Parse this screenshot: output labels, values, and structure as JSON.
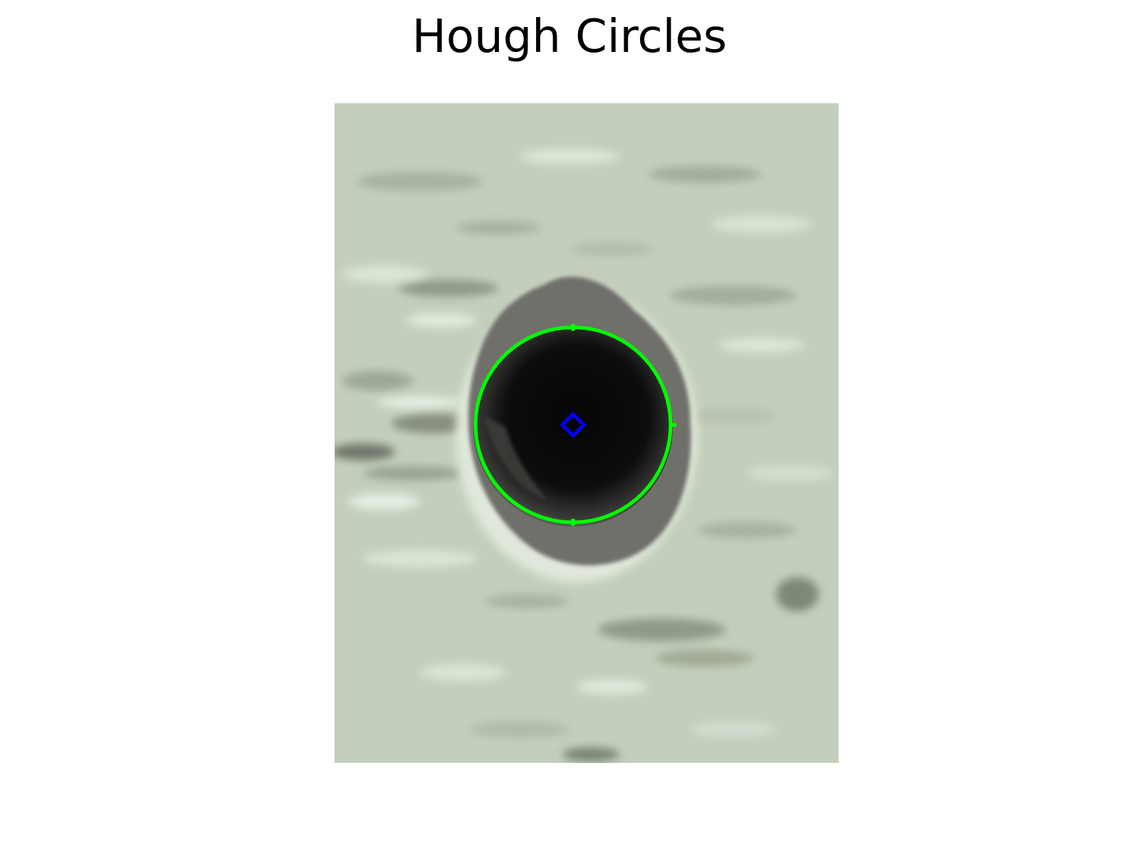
{
  "title": "Hough Circles",
  "image": {
    "description_tag": "pale-green-textured-surface-with-dark-hole",
    "background_color": "#c3cfbc",
    "hole_color": "#0a0a0a",
    "rim_color": "#6e6e68"
  },
  "detection": {
    "circle_color": "#00ff00",
    "center_marker_color": "#0000ff",
    "circles_detected": 1
  }
}
